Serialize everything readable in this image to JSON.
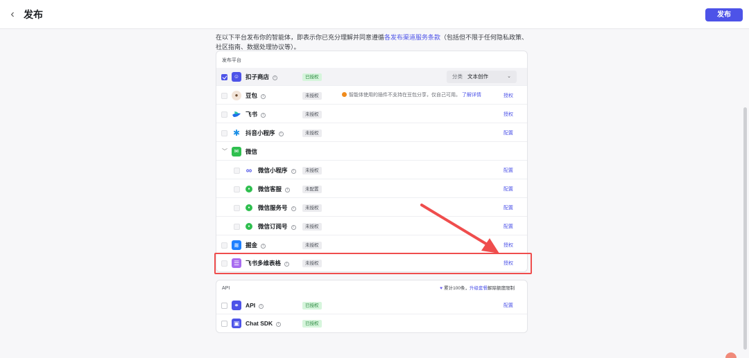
{
  "header": {
    "back_icon": "chevron-left-icon",
    "title": "发布",
    "publish_label": "发布"
  },
  "intro": {
    "before": "在以下平台发布你的智能体，即表示你已充分理解并同意遵循",
    "link": "各发布渠道服务条款",
    "after": "（包括但不限于任何隐私政策、社区指南、数据处理协议等）。"
  },
  "platforms": {
    "section_label": "发布平台",
    "info_glyph": "i",
    "rows": [
      {
        "name": "扣子商店",
        "status": "已授权",
        "action": "",
        "checked": true,
        "icon": "coze-store-icon"
      },
      {
        "name": "豆包",
        "status": "未授权",
        "action": "授权",
        "icon": "doubao-icon"
      },
      {
        "name": "飞书",
        "status": "未授权",
        "action": "授权",
        "icon": "feishu-icon"
      },
      {
        "name": "抖音小程序",
        "status": "未授权",
        "action": "配置",
        "icon": "douyin-miniprogram-icon"
      },
      {
        "name": "微信",
        "status": "",
        "action": "",
        "icon": "wechat-icon"
      },
      {
        "name": "微信小程序",
        "status": "未授权",
        "action": "配置",
        "icon": "wechat-miniprogram-icon"
      },
      {
        "name": "微信客服",
        "status": "未配置",
        "action": "配置",
        "icon": "wechat-service-icon"
      },
      {
        "name": "微信服务号",
        "status": "未授权",
        "action": "配置",
        "icon": "wechat-service-account-icon"
      },
      {
        "name": "微信订阅号",
        "status": "未授权",
        "action": "配置",
        "icon": "wechat-subscription-icon"
      },
      {
        "name": "掘金",
        "status": "未授权",
        "action": "授权",
        "icon": "juejin-icon"
      },
      {
        "name": "飞书多维表格",
        "status": "未授权",
        "action": "授权",
        "icon": "feishu-bitable-icon"
      }
    ],
    "category": {
      "label": "分类",
      "value": "文本创作"
    },
    "doubao_warning": {
      "text": "智能体使用的插件不支持在豆包分享，仅自己可用。",
      "link": "了解详情"
    },
    "wechat_toggle": "﹀"
  },
  "api": {
    "section_label": "API",
    "quota": {
      "prefix": "累计100条，",
      "link": "升级套餐",
      "suffix": "解除额度限制"
    },
    "rows": [
      {
        "name": "API",
        "status": "已授权",
        "action": "配置",
        "icon": "api-link-icon"
      },
      {
        "name": "Chat SDK",
        "status": "已授权",
        "action": "",
        "icon": "chat-sdk-icon"
      }
    ]
  },
  "colors": {
    "accent": "#4d53e8",
    "highlight": "#ef4d4d",
    "authorized_bg": "#d6f5dc",
    "authorized_text": "#2d8a42"
  }
}
